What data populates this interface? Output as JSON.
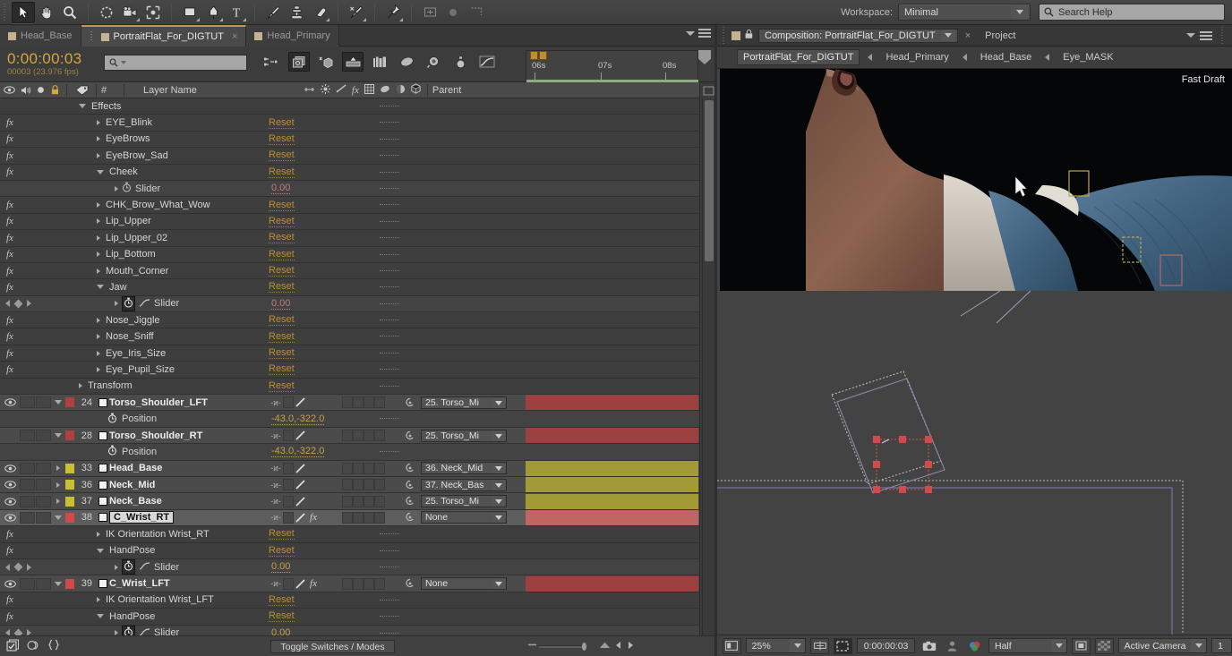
{
  "toolbar": {
    "tools": [
      "selection-tool",
      "hand-tool",
      "zoom-tool",
      "rotation-tool",
      "camera-tool",
      "pan-behind-tool",
      "shape-tool",
      "pen-tool",
      "text-tool",
      "brush-tool",
      "clone-stamp-tool",
      "eraser-tool",
      "roto-brush-tool",
      "puppet-pin-tool"
    ],
    "workspace_label": "Workspace:",
    "workspace_value": "Minimal",
    "search_help_placeholder": "Search Help"
  },
  "left_tabs": [
    {
      "label": "Head_Base",
      "active": false,
      "closable": false
    },
    {
      "label": "PortraitFlat_For_DIGTUT",
      "active": true,
      "closable": true
    },
    {
      "label": "Head_Primary",
      "active": false,
      "closable": false
    }
  ],
  "timeline": {
    "timecode": "0:00:00:03",
    "frame_info": "00003 (23.976 fps)",
    "search_placeholder": "",
    "ruler_ticks": [
      "06s",
      "07s",
      "08s"
    ],
    "columns": {
      "num": "#",
      "layer_name": "Layer Name",
      "parent": "Parent"
    },
    "toggle_switches": "Toggle Switches / Modes",
    "reset_label": "Reset",
    "rows": [
      {
        "kind": "group",
        "indent": 88,
        "label": "Effects",
        "arrow": "open",
        "value": null,
        "fx": false
      },
      {
        "kind": "effect",
        "indent": 108,
        "label": "EYE_Blink",
        "arrow": "closed",
        "value": "Reset",
        "fx": true
      },
      {
        "kind": "effect",
        "indent": 108,
        "label": "EyeBrows",
        "arrow": "closed",
        "value": "Reset",
        "fx": true
      },
      {
        "kind": "effect",
        "indent": 108,
        "label": "EyeBrow_Sad",
        "arrow": "closed",
        "value": "Reset",
        "fx": true
      },
      {
        "kind": "effect",
        "indent": 108,
        "label": "Cheek",
        "arrow": "open",
        "value": "Reset",
        "fx": true
      },
      {
        "kind": "slider",
        "indent": 128,
        "label": "Slider",
        "arrow": "closed",
        "value": "0.00",
        "fx": false,
        "stopwatch": false,
        "graph": false,
        "kfnav": false,
        "valcolor": "#c07a7a"
      },
      {
        "kind": "effect",
        "indent": 108,
        "label": "CHK_Brow_What_Wow",
        "arrow": "closed",
        "value": "Reset",
        "fx": true
      },
      {
        "kind": "effect",
        "indent": 108,
        "label": "Lip_Upper",
        "arrow": "closed",
        "value": "Reset",
        "fx": true
      },
      {
        "kind": "effect",
        "indent": 108,
        "label": "Lip_Upper_02",
        "arrow": "closed",
        "value": "Reset",
        "fx": true
      },
      {
        "kind": "effect",
        "indent": 108,
        "label": "Lip_Bottom",
        "arrow": "closed",
        "value": "Reset",
        "fx": true
      },
      {
        "kind": "effect",
        "indent": 108,
        "label": "Mouth_Corner",
        "arrow": "closed",
        "value": "Reset",
        "fx": true
      },
      {
        "kind": "effect",
        "indent": 108,
        "label": "Jaw",
        "arrow": "open",
        "value": "Reset",
        "fx": true
      },
      {
        "kind": "slider",
        "indent": 128,
        "label": "Slider",
        "arrow": "closed",
        "value": "0.00",
        "fx": false,
        "stopwatch": true,
        "graph": true,
        "kfnav": true,
        "valcolor": "#c07a7a"
      },
      {
        "kind": "effect",
        "indent": 108,
        "label": "Nose_Jiggle",
        "arrow": "closed",
        "value": "Reset",
        "fx": true
      },
      {
        "kind": "effect",
        "indent": 108,
        "label": "Nose_Sniff",
        "arrow": "closed",
        "value": "Reset",
        "fx": true
      },
      {
        "kind": "effect",
        "indent": 108,
        "label": "Eye_Iris_Size",
        "arrow": "closed",
        "value": "Reset",
        "fx": true
      },
      {
        "kind": "effect",
        "indent": 108,
        "label": "Eye_Pupil_Size",
        "arrow": "closed",
        "value": "Reset",
        "fx": true
      },
      {
        "kind": "group",
        "indent": 88,
        "label": "Transform",
        "arrow": "closed",
        "value": "Reset",
        "fx": false
      },
      {
        "kind": "layer",
        "num": "24",
        "label": "Torso_Shoulder_LFT",
        "color": "#b04040",
        "bar": "#9e4040",
        "eye": true,
        "arrow": "open",
        "parent": "25. Torso_Mi",
        "fx": false,
        "switches": true
      },
      {
        "kind": "property",
        "indent": 120,
        "label": "Position",
        "value": "-43.0,-322.0",
        "stopwatch": true,
        "valcolor": "#c4a14a"
      },
      {
        "kind": "layer",
        "num": "28",
        "label": "Torso_Shoulder_RT",
        "color": "#b04040",
        "bar": "#9e4040",
        "eye": false,
        "arrow": "open",
        "parent": "25. Torso_Mi",
        "fx": false,
        "switches": true
      },
      {
        "kind": "property",
        "indent": 120,
        "label": "Position",
        "value": "-43.0,-322.0",
        "stopwatch": true,
        "valcolor": "#c4a14a"
      },
      {
        "kind": "layer",
        "num": "33",
        "label": "Head_Base",
        "color": "#c8c030",
        "bar": "#a29a35",
        "eye": true,
        "arrow": "closed",
        "parent": "36. Neck_Mid",
        "fx": false,
        "switches": true
      },
      {
        "kind": "layer",
        "num": "36",
        "label": "Neck_Mid",
        "color": "#c8c030",
        "bar": "#a29a35",
        "eye": true,
        "arrow": "closed",
        "parent": "37. Neck_Bas",
        "fx": false,
        "switches": true
      },
      {
        "kind": "layer",
        "num": "37",
        "label": "Neck_Base",
        "color": "#c8c030",
        "bar": "#a29a35",
        "eye": true,
        "arrow": "closed",
        "parent": "25. Torso_Mi",
        "fx": false,
        "switches": true
      },
      {
        "kind": "layer",
        "num": "38",
        "label": "C_Wrist_RT",
        "color": "#d04a4a",
        "bar": "#c06464",
        "eye": true,
        "arrow": "open",
        "parent": "None",
        "fx": true,
        "switches": true,
        "selected": true
      },
      {
        "kind": "effect",
        "indent": 108,
        "label": "IK Orientation Wrist_RT",
        "arrow": "closed",
        "value": "Reset",
        "fx": true
      },
      {
        "kind": "effect",
        "indent": 108,
        "label": "HandPose",
        "arrow": "open",
        "value": "Reset",
        "fx": true
      },
      {
        "kind": "slider",
        "indent": 128,
        "label": "Slider",
        "arrow": "closed",
        "value": "0.00",
        "fx": false,
        "stopwatch": true,
        "graph": true,
        "kfnav": true,
        "valcolor": "#c4a14a"
      },
      {
        "kind": "layer",
        "num": "39",
        "label": "C_Wrist_LFT",
        "color": "#d04a4a",
        "bar": "#9e4040",
        "eye": true,
        "arrow": "open",
        "parent": "None",
        "fx": true,
        "switches": true
      },
      {
        "kind": "effect",
        "indent": 108,
        "label": "IK Orientation Wrist_LFT",
        "arrow": "closed",
        "value": "Reset",
        "fx": true
      },
      {
        "kind": "effect",
        "indent": 108,
        "label": "HandPose",
        "arrow": "open",
        "value": "Reset",
        "fx": true
      },
      {
        "kind": "slider",
        "indent": 128,
        "label": "Slider",
        "arrow": "closed",
        "value": "0.00",
        "fx": false,
        "stopwatch": true,
        "graph": true,
        "kfnav": true,
        "valcolor": "#c4a14a"
      }
    ]
  },
  "composition": {
    "panel_tab": "Composition: PortraitFlat_For_DIGTUT",
    "project_tab": "Project",
    "breadcrumbs": [
      "PortraitFlat_For_DIGTUT",
      "Head_Primary",
      "Head_Base",
      "Eye_MASK"
    ],
    "fast_draft": "Fast Draft",
    "viewer_bar": {
      "zoom": "25%",
      "timecode": "0:00:00:03",
      "resolution": "Half",
      "camera": "Active Camera",
      "views": "1"
    }
  }
}
